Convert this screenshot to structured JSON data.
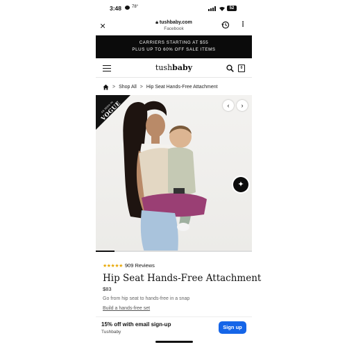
{
  "status_bar": {
    "time": "3:48",
    "temp": "78°",
    "battery": "52"
  },
  "browser": {
    "domain": "tushbaby.com",
    "source": "Facebook",
    "close_icon": "×",
    "more_icon": "⋮"
  },
  "promo": {
    "line1": "CARRIERS STARTING AT $55",
    "line2": "PLUS UP TO 60% OFF SALE ITEMS"
  },
  "header": {
    "logo_light": "tush",
    "logo_bold": "baby",
    "bag_count": "0"
  },
  "breadcrumb": {
    "items": [
      "Shop All",
      "Hip Seat Hands-Free Attachment"
    ],
    "separator": ">"
  },
  "hero": {
    "badge_prefix": "AS SEEN IN",
    "badge_brand": "VOGUE",
    "prev_icon": "‹",
    "next_icon": "›",
    "sparkle_icon": "✦",
    "slide_progress": 0.12
  },
  "product": {
    "stars": "★★★★★",
    "reviews": "909 Reviews",
    "title": "Hip Seat Hands-Free Attachment",
    "price": "$83",
    "description": "Go from hip seat to hands-free in a snap",
    "link": "Build a hands-free set"
  },
  "signup": {
    "title": "15% off with email sign-up",
    "subtitle": "Tushbaby",
    "button": "Sign up"
  },
  "colors": {
    "promo_bg": "#0b0b0b",
    "star": "#e8a700",
    "signup_button": "#1565e8"
  }
}
